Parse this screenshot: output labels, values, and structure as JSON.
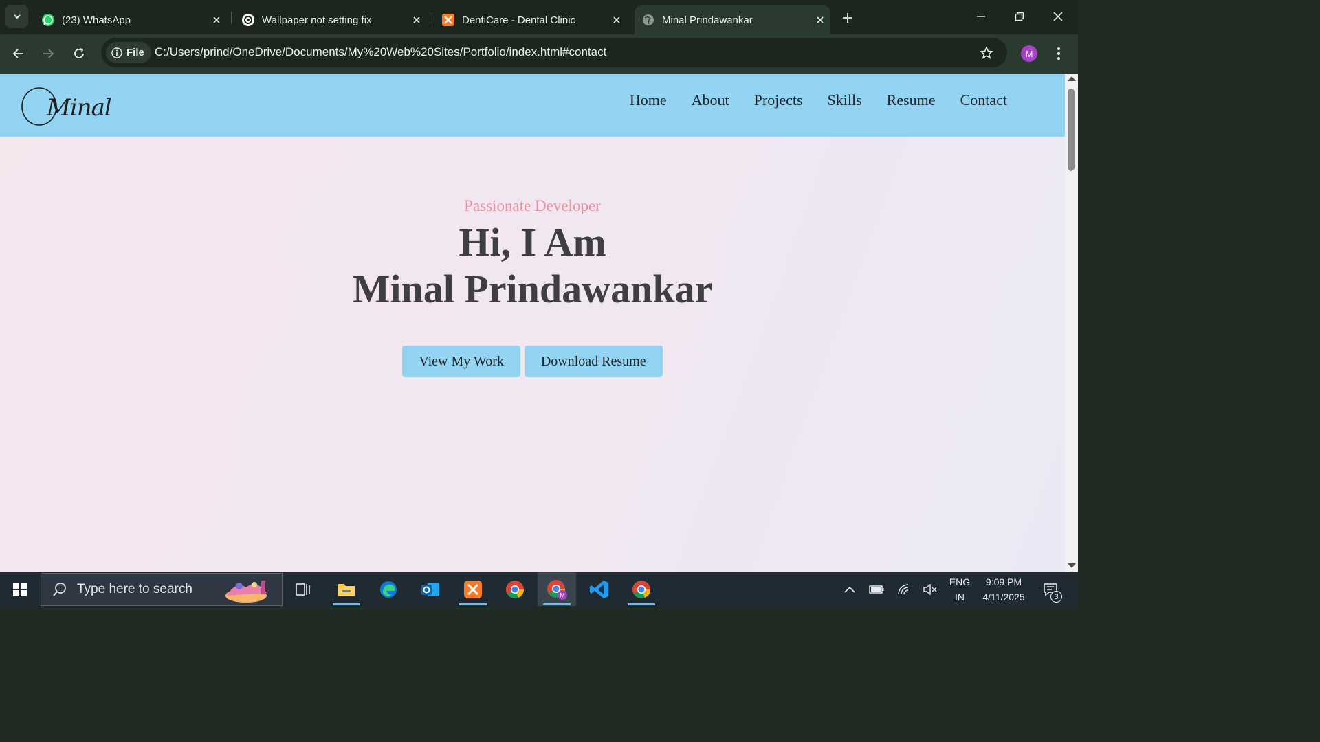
{
  "browser": {
    "tabs": [
      {
        "title": "(23) WhatsApp",
        "icon": "whatsapp-icon",
        "active": false
      },
      {
        "title": "Wallpaper not setting fix",
        "icon": "chatgpt-icon",
        "active": false
      },
      {
        "title": "DentiCare - Dental Clinic",
        "icon": "xampp-icon",
        "active": false
      },
      {
        "title": "Minal Prindawankar",
        "icon": "globe-icon",
        "active": true
      }
    ],
    "site_chip_label": "File",
    "url": "C:/Users/prind/OneDrive/Documents/My%20Web%20Sites/Portfolio/index.html#contact",
    "profile_initial": "M"
  },
  "site": {
    "logo_text": "Minal",
    "nav": [
      "Home",
      "About",
      "Projects",
      "Skills",
      "Resume",
      "Contact"
    ],
    "hero": {
      "eyebrow": "Passionate Developer",
      "title_line1": "Hi, I Am",
      "title_line2": "Minal Prindawankar",
      "primary_button": "View My Work",
      "secondary_button": "Download Resume"
    }
  },
  "taskbar": {
    "search_placeholder": "Type here to search",
    "apps": [
      "task-view-icon",
      "file-explorer-icon",
      "edge-icon",
      "outlook-icon",
      "xampp-icon",
      "chrome-icon",
      "chrome-profile-icon",
      "vscode-icon",
      "chrome-icon"
    ],
    "language_line1": "ENG",
    "language_line2": "IN",
    "time": "9:09 PM",
    "date": "4/11/2025",
    "notification_count": "3"
  },
  "colors": {
    "site_header": "#93d4f2",
    "accent_pink": "#ec8fa0",
    "hero_text": "#3f3f41",
    "browser_frame": "#1c261f"
  }
}
